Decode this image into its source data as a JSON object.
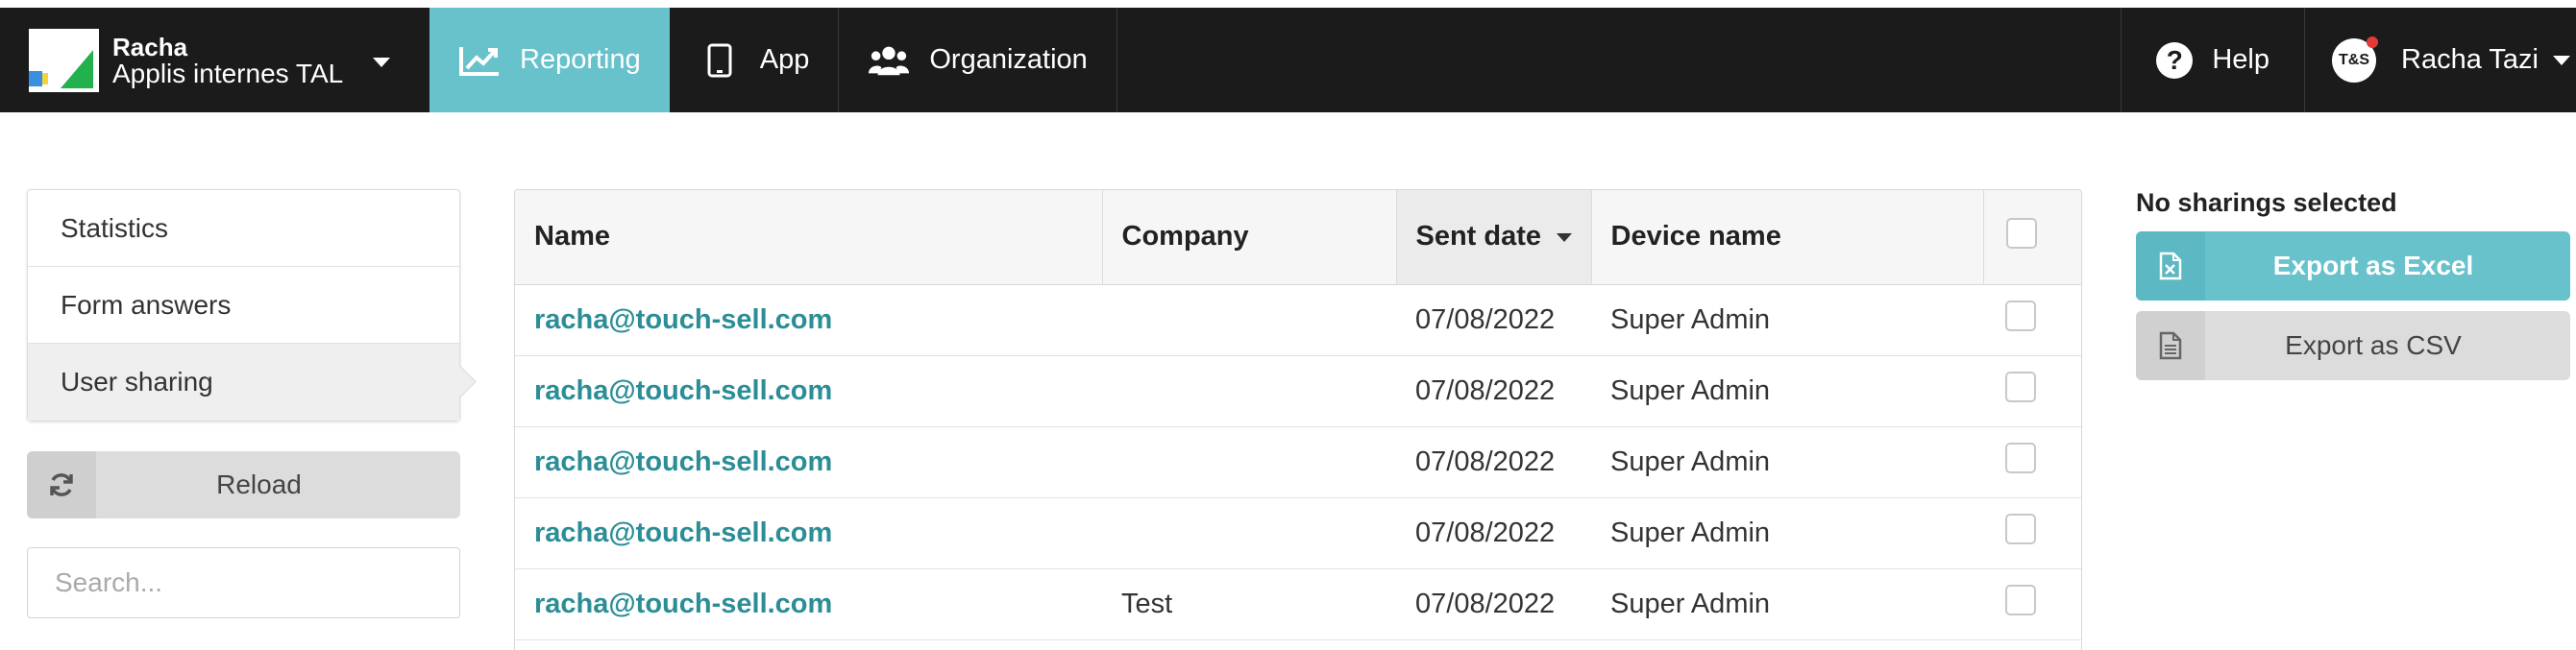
{
  "brand": {
    "name": "Racha",
    "subtitle": "Applis internes TAL"
  },
  "nav": {
    "tabs": [
      {
        "label": "Reporting",
        "icon": "chart-line-icon",
        "active": true
      },
      {
        "label": "App",
        "icon": "tablet-icon"
      },
      {
        "label": "Organization",
        "icon": "users-icon"
      }
    ],
    "help_label": "Help",
    "user": {
      "avatar_text": "T&S",
      "name": "Racha Tazi"
    }
  },
  "sidebar": {
    "items": [
      {
        "label": "Statistics"
      },
      {
        "label": "Form answers"
      },
      {
        "label": "User sharing",
        "active": true
      }
    ],
    "reload_label": "Reload",
    "search_placeholder": "Search..."
  },
  "table": {
    "columns": [
      "Name",
      "Company",
      "Sent date",
      "Device name"
    ],
    "sorted_column": "Sent date",
    "rows": [
      {
        "name": "racha@touch-sell.com",
        "company": "",
        "sent_date": "07/08/2022",
        "device": "Super Admin"
      },
      {
        "name": "racha@touch-sell.com",
        "company": "",
        "sent_date": "07/08/2022",
        "device": "Super Admin"
      },
      {
        "name": "racha@touch-sell.com",
        "company": "",
        "sent_date": "07/08/2022",
        "device": "Super Admin"
      },
      {
        "name": "racha@touch-sell.com",
        "company": "",
        "sent_date": "07/08/2022",
        "device": "Super Admin"
      },
      {
        "name": "racha@touch-sell.com",
        "company": "Test",
        "sent_date": "07/08/2022",
        "device": "Super Admin"
      }
    ]
  },
  "export": {
    "status": "No sharings selected",
    "excel_label": "Export as Excel",
    "csv_label": "Export as CSV"
  },
  "colors": {
    "topbar": "#1b1b1b",
    "accent": "#67c2cc",
    "link": "#2b8e96"
  }
}
